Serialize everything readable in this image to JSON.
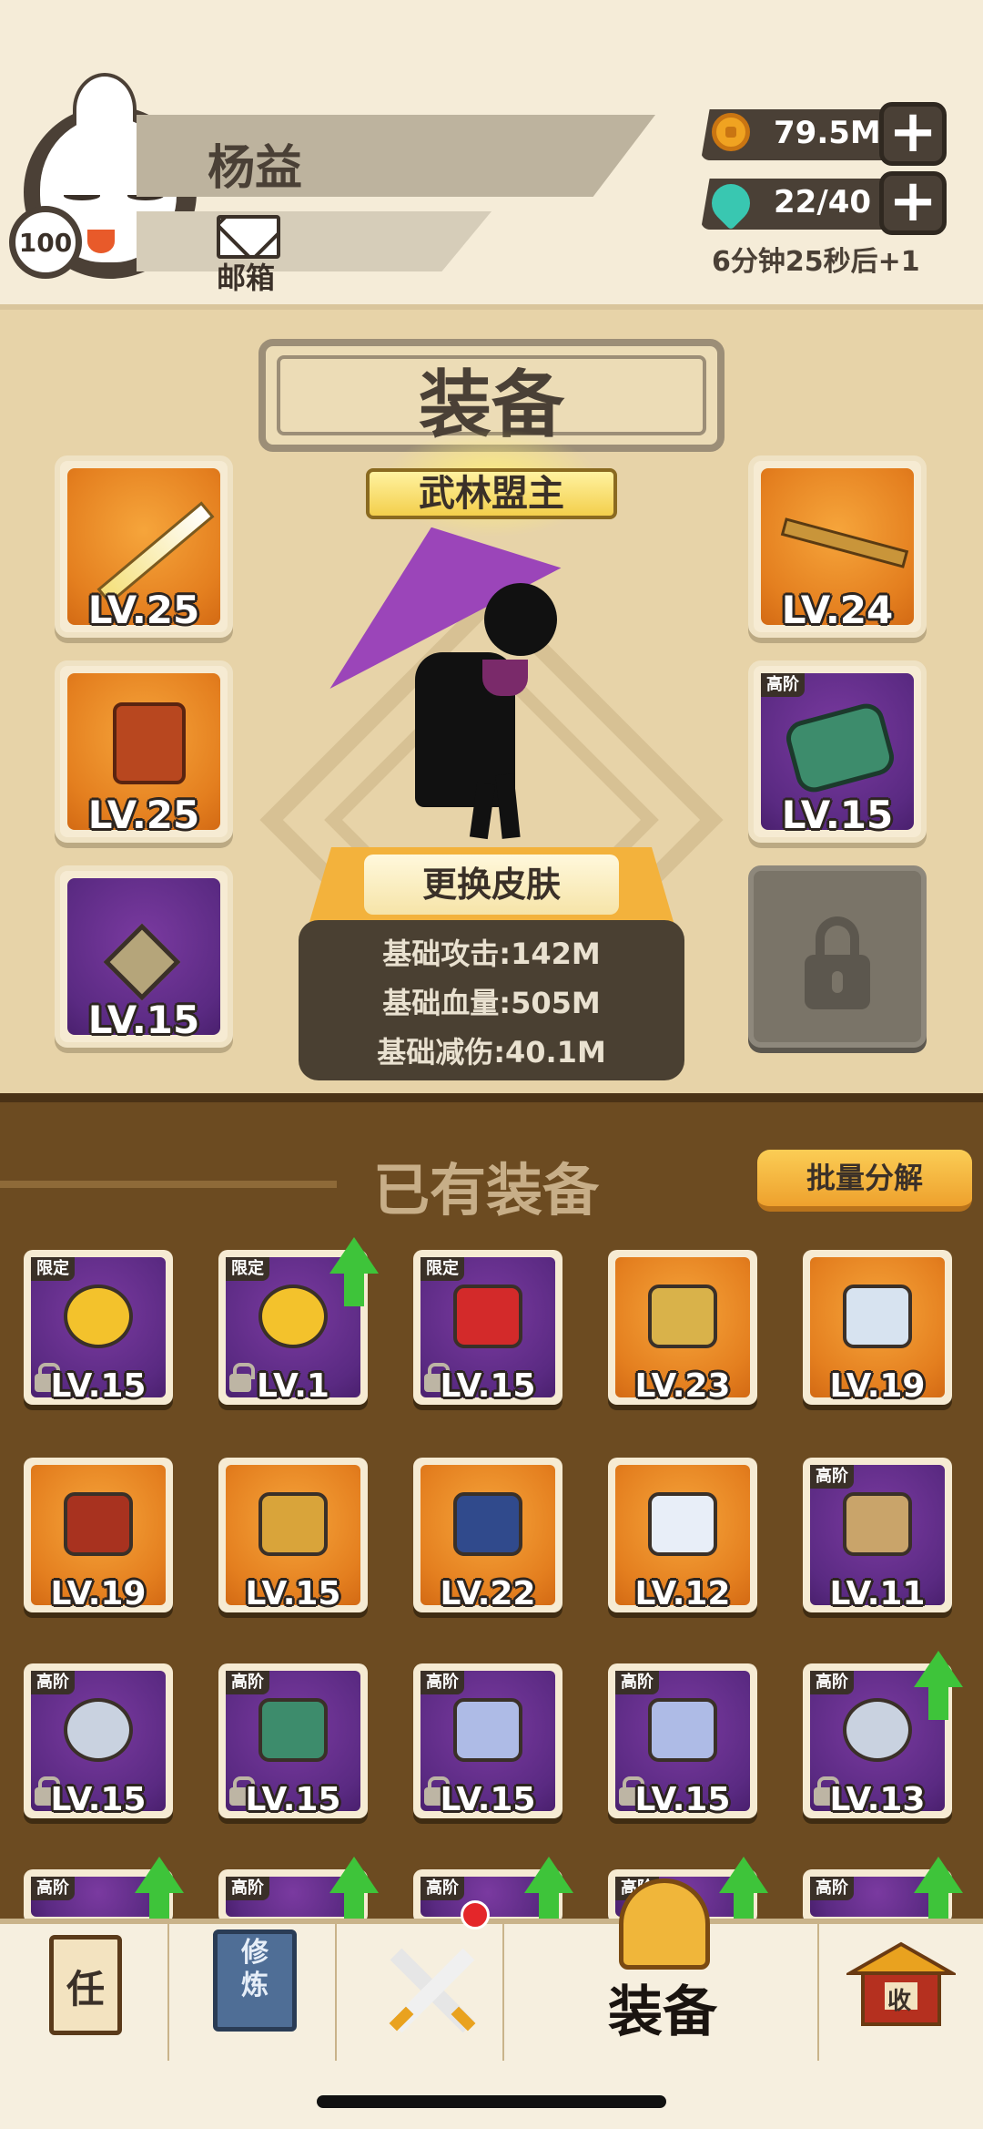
{
  "player": {
    "name": "杨益",
    "level": "100",
    "mail_label": "邮箱"
  },
  "currency": {
    "coins": "79.5M",
    "energy": "22/40",
    "energy_timer": "6分钟25秒后+1"
  },
  "equip": {
    "title": "装备",
    "rank": "武林盟主",
    "change_skin": "更换皮肤",
    "stats": [
      "基础攻击:142M",
      "基础血量:505M",
      "基础减伤:40.1M"
    ],
    "left_slots": [
      {
        "level": "LV.25",
        "rarity": "orange",
        "icon": "sword-icon"
      },
      {
        "level": "LV.25",
        "rarity": "orange",
        "icon": "armor-icon"
      },
      {
        "level": "LV.15",
        "rarity": "purple",
        "icon": "necklace-icon"
      }
    ],
    "right_slots": [
      {
        "level": "LV.24",
        "rarity": "orange",
        "icon": "key-icon"
      },
      {
        "level": "LV.15",
        "rarity": "purple",
        "tag": "高阶",
        "icon": "bracer-icon"
      },
      {
        "locked": true,
        "icon": "lock-icon"
      }
    ]
  },
  "owned": {
    "title": "已有装备",
    "bulk_button": "批量分解",
    "rows": [
      [
        {
          "level": "LV.15",
          "rarity": "purple",
          "tag": "限定",
          "icon": "gold-ingot-icon",
          "locked": true,
          "upgrade": false
        },
        {
          "level": "LV.1",
          "rarity": "purple",
          "tag": "限定",
          "icon": "gold-ingot-icon",
          "locked": true,
          "upgrade": true
        },
        {
          "level": "LV.15",
          "rarity": "purple",
          "tag": "限定",
          "icon": "chinese-knot-icon",
          "locked": true,
          "upgrade": false
        },
        {
          "level": "LV.23",
          "rarity": "orange",
          "tag": "",
          "icon": "spear-icon",
          "locked": false,
          "upgrade": false
        },
        {
          "level": "LV.19",
          "rarity": "orange",
          "tag": "",
          "icon": "sword-icon",
          "locked": false,
          "upgrade": false
        }
      ],
      [
        {
          "level": "LV.19",
          "rarity": "orange",
          "tag": "",
          "icon": "staff-icon",
          "locked": false,
          "upgrade": false
        },
        {
          "level": "LV.15",
          "rarity": "orange",
          "tag": "",
          "icon": "mace-icon",
          "locked": false,
          "upgrade": false
        },
        {
          "level": "LV.22",
          "rarity": "orange",
          "tag": "",
          "icon": "hat-icon",
          "locked": false,
          "upgrade": false
        },
        {
          "level": "LV.12",
          "rarity": "orange",
          "tag": "",
          "icon": "robe-icon",
          "locked": false,
          "upgrade": false
        },
        {
          "level": "LV.11",
          "rarity": "purple",
          "tag": "高阶",
          "icon": "straw-hat-icon",
          "locked": false,
          "upgrade": false
        }
      ],
      [
        {
          "level": "LV.15",
          "rarity": "purple",
          "tag": "高阶",
          "icon": "ring-icon",
          "locked": true,
          "upgrade": false
        },
        {
          "level": "LV.15",
          "rarity": "purple",
          "tag": "高阶",
          "icon": "bracer-icon",
          "locked": true,
          "upgrade": false
        },
        {
          "level": "LV.15",
          "rarity": "purple",
          "tag": "高阶",
          "icon": "amulet-icon",
          "locked": true,
          "upgrade": false
        },
        {
          "level": "LV.15",
          "rarity": "purple",
          "tag": "高阶",
          "icon": "amulet-icon",
          "locked": true,
          "upgrade": false
        },
        {
          "level": "LV.13",
          "rarity": "purple",
          "tag": "高阶",
          "icon": "ring-icon",
          "locked": true,
          "upgrade": true
        }
      ],
      [
        {
          "level": "",
          "rarity": "purple",
          "tag": "高阶",
          "icon": "item-icon",
          "locked": false,
          "upgrade": true
        },
        {
          "level": "",
          "rarity": "purple",
          "tag": "高阶",
          "icon": "item-icon",
          "locked": false,
          "upgrade": true
        },
        {
          "level": "",
          "rarity": "purple",
          "tag": "高阶",
          "icon": "item-icon",
          "locked": false,
          "upgrade": true
        },
        {
          "level": "",
          "rarity": "purple",
          "tag": "高阶",
          "icon": "item-icon",
          "locked": false,
          "upgrade": true
        },
        {
          "level": "",
          "rarity": "purple",
          "tag": "高阶",
          "icon": "item-icon",
          "locked": false,
          "upgrade": true
        }
      ]
    ]
  },
  "nav": {
    "task_glyph": "任",
    "cultivate_glyph": "修炼",
    "equip_label": "装备",
    "shop_glyph": "收"
  },
  "colors": {
    "orange_frame": "#e47f1f",
    "purple_frame": "#5a2a82",
    "upgrade_arrow": "#3ec43a",
    "owned_bg": "#6c4b21"
  }
}
